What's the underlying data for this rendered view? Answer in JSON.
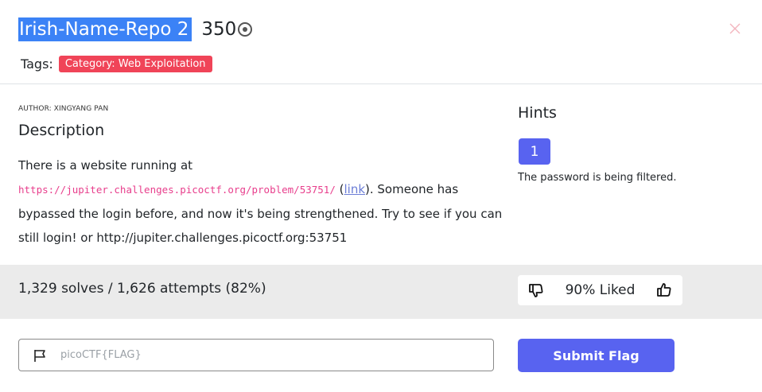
{
  "challenge": {
    "title": "Irish-Name-Repo 2",
    "points": "350",
    "tags_label": "Tags:",
    "tag": "Category: Web Exploitation",
    "author": "AUTHOR: XINGYANG PAN",
    "description_title": "Description",
    "desc_intro": "There is a website running at",
    "desc_url": "https://jupiter.challenges.picoctf.org/problem/53751/",
    "desc_link_open": " (",
    "desc_link": "link",
    "desc_rest": "). Someone has bypassed the login before, and now it's being strengthened. Try to see if you can still login! or http://jupiter.challenges.picoctf.org:53751"
  },
  "hints": {
    "title": "Hints",
    "button": "1",
    "text": "The password is being filtered."
  },
  "stats": {
    "solves": "1,329 solves / 1,626 attempts (82%)",
    "liked": "90% Liked"
  },
  "flag": {
    "placeholder": "picoCTF{FLAG}",
    "submit": "Submit Flag"
  },
  "colors": {
    "accent": "#5863f0",
    "tag": "#f04458",
    "title_highlight": "#3b82f6",
    "code": "#e83e8c"
  }
}
